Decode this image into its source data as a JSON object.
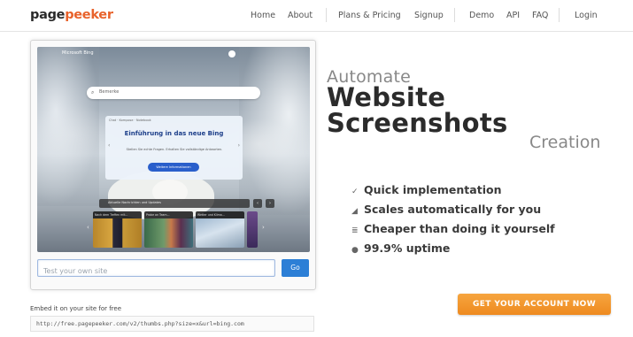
{
  "header": {
    "logo_part1": "page",
    "logo_part2": "peeker",
    "nav": {
      "home": "Home",
      "about": "About",
      "plans": "Plans & Pricing",
      "signup": "Signup",
      "demo": "Demo",
      "api": "API",
      "faq": "FAQ",
      "login": "Login"
    }
  },
  "preview": {
    "test_placeholder": "Test your own site",
    "go_label": "Go",
    "bing": {
      "logo": "Microsoft Bing",
      "search_placeholder": "Bemerke",
      "search_icon": "search-icon",
      "popup_tabs": "Chat · Kompose · Notebook",
      "popup_title": "Einführung in das neue Bing",
      "popup_subtitle": "Stellen Sie echte Fragen. Erhalten Sie vollständige Antworten.",
      "popup_button": "Weitere Informationen",
      "bar_text": "Aktuelle Nachrichten und Updates",
      "news": [
        {
          "caption": "Nach dem Treffen mit..."
        },
        {
          "caption": "Probe an Team..."
        },
        {
          "caption": "Wetter und Klima..."
        }
      ]
    }
  },
  "embed": {
    "label": "Embed it on your site for free",
    "code": "http://free.pagepeeker.com/v2/thumbs.php?size=x&url=bing.com"
  },
  "hero": {
    "line1": "Automate",
    "line2": "Website",
    "line3": "Screenshots",
    "line4": "Creation"
  },
  "features": [
    {
      "icon": "pencil-icon",
      "glyph": "✓",
      "text": "Quick implementation"
    },
    {
      "icon": "chart-icon",
      "glyph": "◢",
      "text": "Scales automatically for you"
    },
    {
      "icon": "list-icon",
      "glyph": "≣",
      "text": "Cheaper than doing it yourself"
    },
    {
      "icon": "circle-icon",
      "glyph": "●",
      "text": "99.9% uptime"
    }
  ],
  "cta": {
    "label": "GET YOUR ACCOUNT NOW"
  },
  "colors": {
    "brand_orange": "#e8622b",
    "cta_orange": "#ee8a1f",
    "go_blue": "#2c7fd6"
  }
}
